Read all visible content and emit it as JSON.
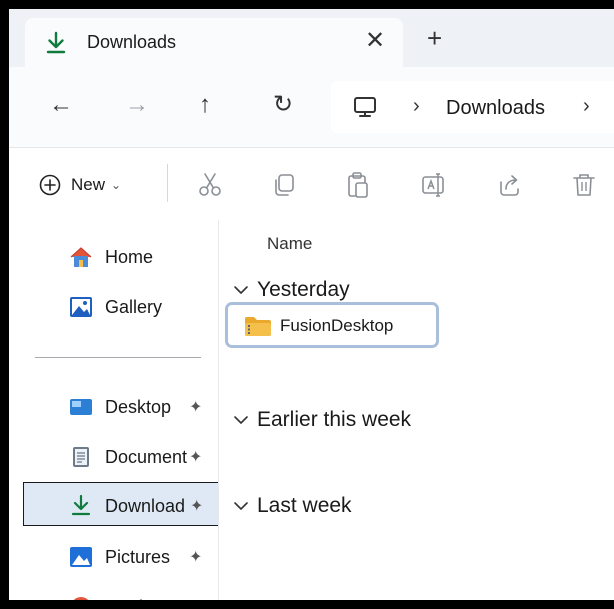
{
  "tab": {
    "title": "Downloads",
    "close_label": "✕",
    "new_tab_label": "+"
  },
  "nav": {
    "back": "←",
    "forward": "→",
    "up": "↑",
    "refresh": "↻",
    "address_separator": "›",
    "breadcrumb": "Downloads"
  },
  "toolbar": {
    "new_label": "New",
    "new_caret": "⌄",
    "tools": [
      "scissors-icon",
      "copy-icon",
      "paste-icon",
      "rename-icon",
      "share-icon",
      "delete-icon"
    ]
  },
  "sidebar": {
    "items": [
      {
        "label": "Home",
        "icon": "home-icon"
      },
      {
        "label": "Gallery",
        "icon": "gallery-icon"
      },
      {
        "label": "Desktop",
        "icon": "desktop-folder-icon",
        "pin": "📌"
      },
      {
        "label": "Document",
        "icon": "documents-folder-icon",
        "pin": "📌"
      },
      {
        "label": "Download",
        "icon": "download-icon",
        "pin": "📌",
        "selected": true
      },
      {
        "label": "Pictures",
        "icon": "pictures-folder-icon",
        "pin": "📌"
      },
      {
        "label": "Music",
        "icon": "music-folder-icon",
        "pin": "📌"
      }
    ]
  },
  "content": {
    "column_name": "Name",
    "groups": [
      {
        "label": "Yesterday",
        "files": [
          {
            "name": "FusionDesktop",
            "icon": "zip-folder-icon"
          }
        ]
      },
      {
        "label": "Earlier this week",
        "files": []
      },
      {
        "label": "Last week",
        "files": []
      }
    ]
  },
  "colors": {
    "accent": "#0f7b3e",
    "selected_bg": "#dfe9f5",
    "folder": "#f4c04b",
    "highlight_border": "#a9bfdc"
  }
}
